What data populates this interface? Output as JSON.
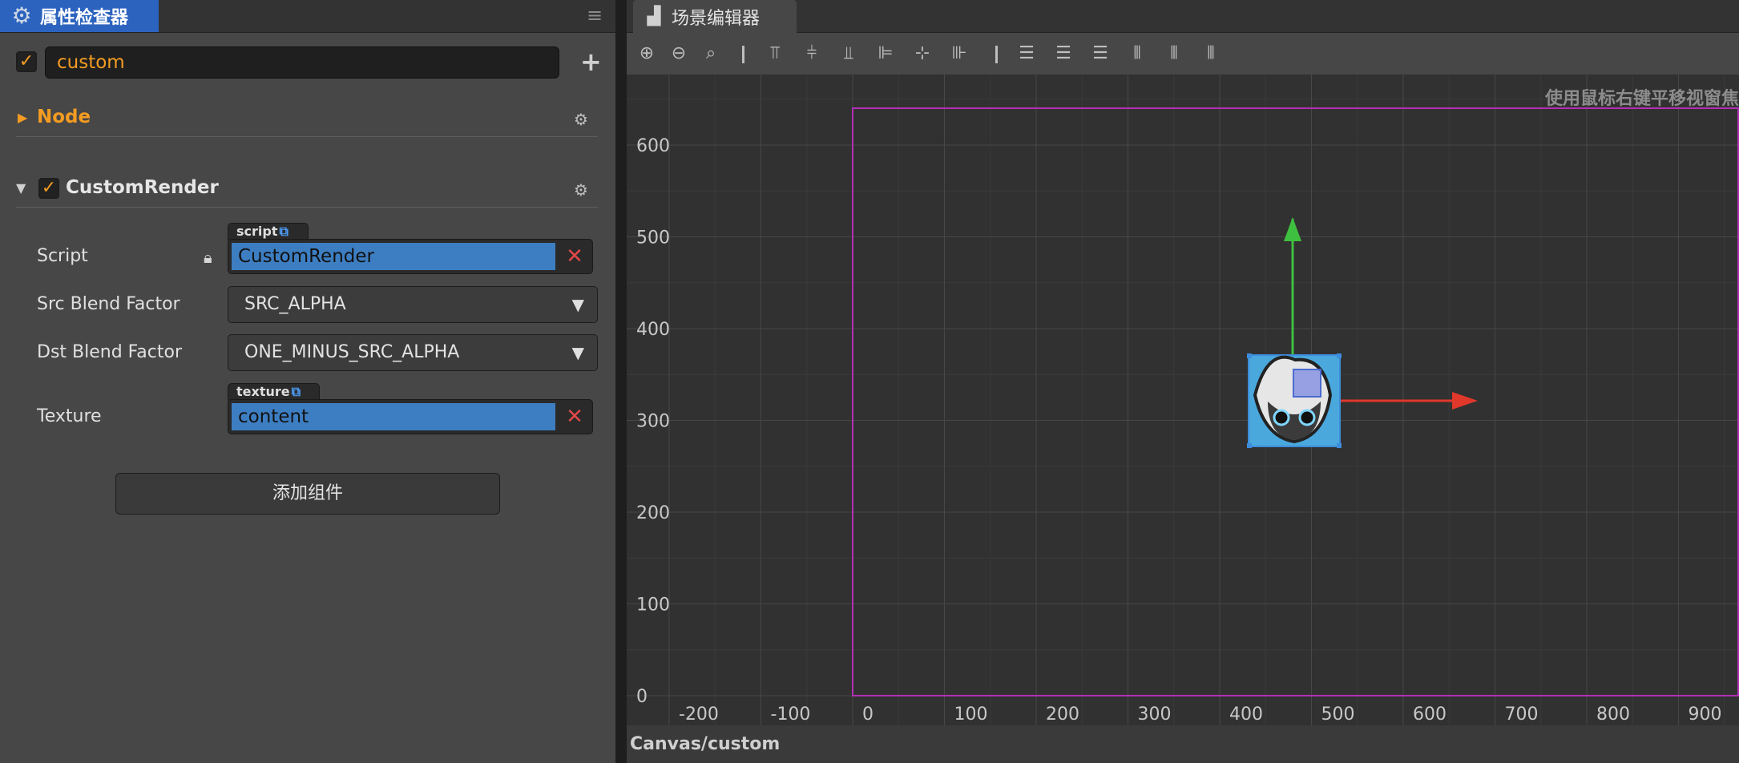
{
  "inspector": {
    "tab_title": "属性检查器",
    "node_enabled": true,
    "node_name": "custom",
    "add_icon": "plus-icon",
    "node_section": "Node",
    "component": {
      "enabled": true,
      "name": "CustomRender",
      "props": {
        "script_label": "Script",
        "script_tag": "script",
        "script_value": "CustomRender",
        "src_label": "Src Blend Factor",
        "src_value": "SRC_ALPHA",
        "dst_label": "Dst Blend Factor",
        "dst_value": "ONE_MINUS_SRC_ALPHA",
        "texture_label": "Texture",
        "texture_tag": "texture",
        "texture_value": "content"
      }
    },
    "add_component": "添加组件"
  },
  "scene": {
    "tab_title": "场景编辑器",
    "hint": "使用鼠标右键平移视窗焦",
    "x_ticks": [
      "-200",
      "-100",
      "0",
      "100",
      "200",
      "300",
      "400",
      "500",
      "600",
      "700",
      "800",
      "900"
    ],
    "y_ticks": [
      "600",
      "500",
      "400",
      "300",
      "200",
      "100",
      "0"
    ],
    "status_path": "Canvas/custom",
    "colors": {
      "canvas_frame": "#b22fb5",
      "x_axis": "#e0382b",
      "y_axis": "#3fbf3f",
      "selection": "#3d8ddc"
    }
  }
}
